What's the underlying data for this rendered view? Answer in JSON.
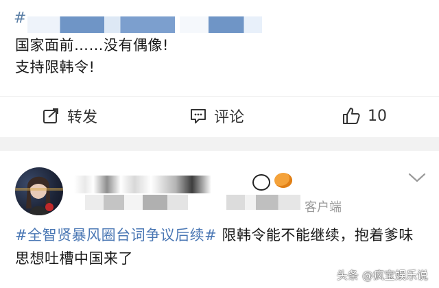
{
  "post1": {
    "tag": "#",
    "lines": [
      "国家面前……没有偶像!",
      "支持限韩令!"
    ],
    "actions": {
      "repost_label": "转发",
      "comment_label": "评论",
      "like_count": "10"
    }
  },
  "post2": {
    "client_text": "客户端",
    "hashtag": "#全智贤暴风圈台词争议后续#",
    "text": " 限韩令能不能继续，抱着爹味思想吐槽中国来了"
  },
  "watermark": {
    "text": "头条 @疯宝娱乐说"
  },
  "colors": {
    "hashtag": "#4a77b4",
    "separator": "#f2f2f2",
    "muted": "#9a9a9a"
  }
}
